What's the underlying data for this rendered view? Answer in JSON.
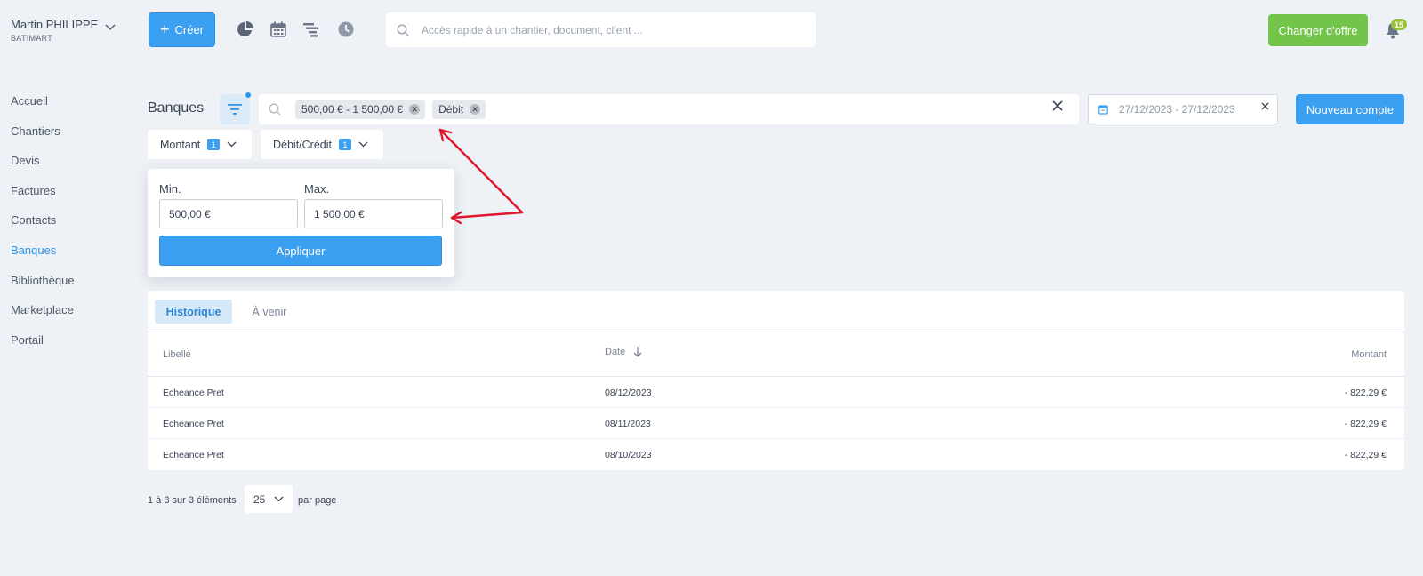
{
  "user": {
    "name": "Martin PHILIPPE",
    "company": "BATIMART"
  },
  "toolbar": {
    "create_label": "Créer",
    "search_placeholder": "Accès rapide à un chantier, document, client ...",
    "offer_label": "Changer d'offre",
    "notifications_count": "15"
  },
  "sidebar": {
    "items": [
      {
        "label": "Accueil"
      },
      {
        "label": "Chantiers"
      },
      {
        "label": "Devis"
      },
      {
        "label": "Factures"
      },
      {
        "label": "Contacts"
      },
      {
        "label": "Banques"
      },
      {
        "label": "Bibliothèque"
      },
      {
        "label": "Marketplace"
      },
      {
        "label": "Portail"
      }
    ],
    "active": "Banques"
  },
  "page": {
    "title": "Banques",
    "filter_chips": [
      {
        "label": "500,00 € - 1 500,00 €"
      },
      {
        "label": "Débit"
      }
    ],
    "date_range": "27/12/2023 - 27/12/2023",
    "new_account_label": "Nouveau compte"
  },
  "filters": {
    "montant": {
      "label": "Montant",
      "count": "1"
    },
    "debit_credit": {
      "label": "Débit/Crédit",
      "count": "1"
    }
  },
  "popover": {
    "min_label": "Min.",
    "max_label": "Max.",
    "min_value": "500,00 €",
    "max_value": "1 500,00 €",
    "apply_label": "Appliquer"
  },
  "table": {
    "tabs": [
      {
        "label": "Historique",
        "active": true
      },
      {
        "label": "À venir",
        "active": false
      }
    ],
    "columns": {
      "label": "Libellé",
      "date": "Date",
      "amount": "Montant"
    },
    "rows": [
      {
        "label": "Echeance Pret",
        "date": "08/12/2023",
        "amount": "- 822,29 €"
      },
      {
        "label": "Echeance Pret",
        "date": "08/11/2023",
        "amount": "- 822,29 €"
      },
      {
        "label": "Echeance Pret",
        "date": "08/10/2023",
        "amount": "- 822,29 €"
      }
    ]
  },
  "pagination": {
    "summary": "1 à 3 sur 3 éléments",
    "page_size": "25",
    "suffix": "par page"
  },
  "colors": {
    "primary": "#3ba0f2",
    "success": "#72c548",
    "annotation": "#e0182d",
    "background": "#eef1f5"
  },
  "icons": {
    "toolbar": [
      "pie-chart-icon",
      "calendar-icon",
      "gantt-icon",
      "clock-icon"
    ],
    "search": "search-icon",
    "notifications": "bell-icon",
    "filter": "filter-icon"
  }
}
